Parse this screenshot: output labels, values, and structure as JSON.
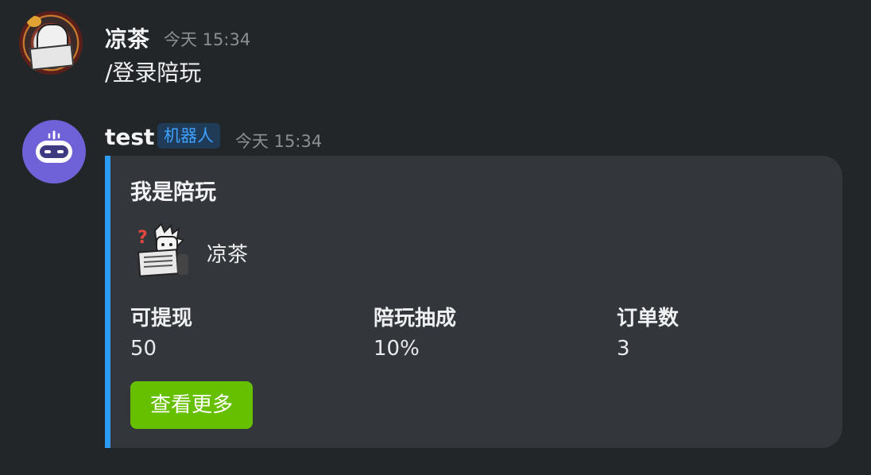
{
  "messages": [
    {
      "author": "凉茶",
      "time": "今天 15:34",
      "text": "/登录陪玩"
    },
    {
      "author": "test",
      "badge": "机器人",
      "time": "今天 15:34",
      "card": {
        "title": "我是陪玩",
        "user_name": "凉茶",
        "fields": [
          {
            "label": "可提现",
            "value": "50"
          },
          {
            "label": "陪玩抽成",
            "value": "10%"
          },
          {
            "label": "订单数",
            "value": "3"
          }
        ],
        "button_label": "查看更多"
      }
    }
  ],
  "colors": {
    "background": "#232629",
    "card_background": "#33363b",
    "card_accent": "#2b9bf4",
    "button": "#66c000",
    "bot_avatar": "#6f62d8",
    "badge_text": "#3ea1ff",
    "badge_background": "#1f3b57"
  },
  "icons": {
    "user_avatar": "anime-character-avatar",
    "bot_avatar": "robot-icon",
    "card_user_avatar": "anime-character-reading-avatar"
  }
}
